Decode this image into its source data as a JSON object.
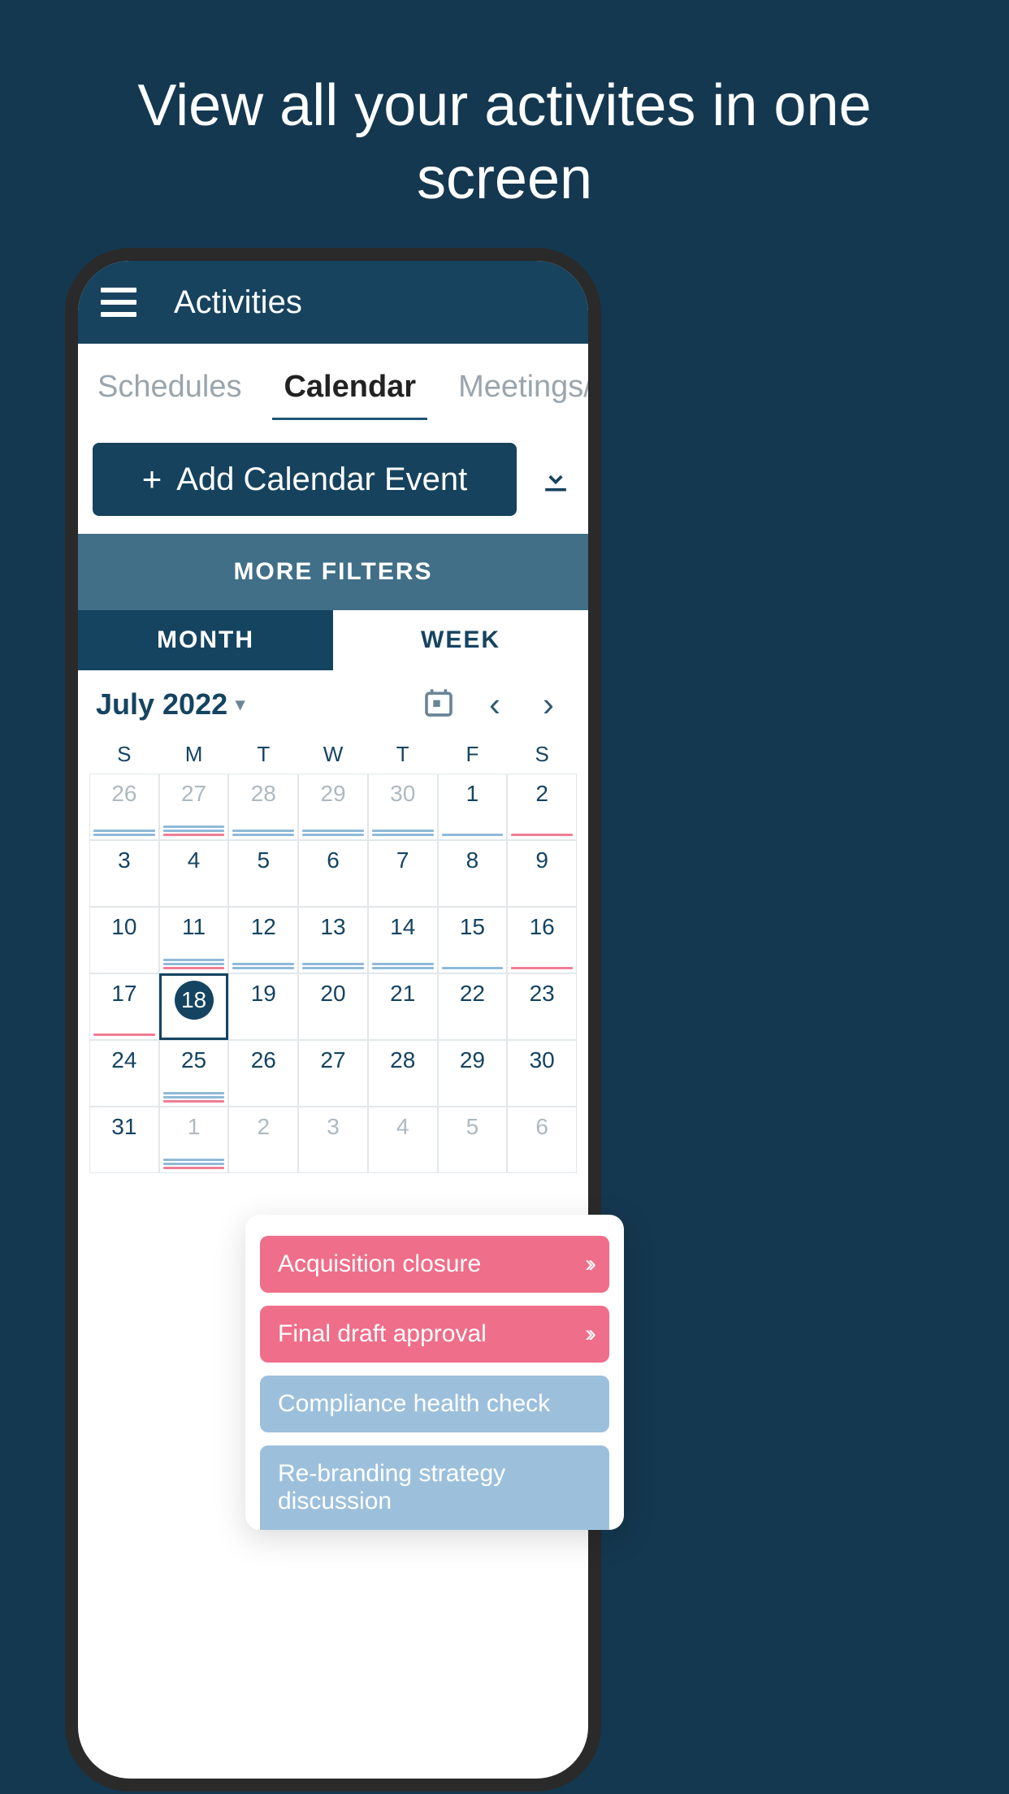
{
  "hero": "View all your activites in one screen",
  "header": {
    "title": "Activities"
  },
  "tabs": {
    "schedules": "Schedules",
    "calendar": "Calendar",
    "meetings": "Meetings/Ev"
  },
  "add_button": "Add Calendar Event",
  "more_filters": "MORE FILTERS",
  "view": {
    "month": "MONTH",
    "week": "WEEK"
  },
  "month_label": "July 2022",
  "weekdays": [
    "S",
    "M",
    "T",
    "W",
    "T",
    "F",
    "S"
  ],
  "weeks": [
    [
      {
        "n": "26",
        "muted": true,
        "marks": [
          "blue",
          "blue"
        ]
      },
      {
        "n": "27",
        "muted": true,
        "marks": [
          "blue",
          "blue",
          "pink"
        ]
      },
      {
        "n": "28",
        "muted": true,
        "marks": [
          "blue",
          "blue"
        ]
      },
      {
        "n": "29",
        "muted": true,
        "marks": [
          "blue",
          "blue"
        ]
      },
      {
        "n": "30",
        "muted": true,
        "marks": [
          "blue",
          "blue"
        ]
      },
      {
        "n": "1",
        "marks": [
          "blue"
        ]
      },
      {
        "n": "2",
        "marks": [
          "pink"
        ]
      }
    ],
    [
      {
        "n": "3"
      },
      {
        "n": "4"
      },
      {
        "n": "5"
      },
      {
        "n": "6"
      },
      {
        "n": "7"
      },
      {
        "n": "8"
      },
      {
        "n": "9"
      }
    ],
    [
      {
        "n": "10"
      },
      {
        "n": "11",
        "marks": [
          "blue",
          "blue",
          "pink"
        ]
      },
      {
        "n": "12",
        "marks": [
          "blue",
          "blue"
        ]
      },
      {
        "n": "13",
        "marks": [
          "blue",
          "blue"
        ]
      },
      {
        "n": "14",
        "marks": [
          "blue",
          "blue"
        ]
      },
      {
        "n": "15",
        "marks": [
          "blue"
        ]
      },
      {
        "n": "16",
        "marks": [
          "pink"
        ]
      }
    ],
    [
      {
        "n": "17",
        "marks": [
          "pink"
        ]
      },
      {
        "n": "18",
        "today": true
      },
      {
        "n": "19"
      },
      {
        "n": "20"
      },
      {
        "n": "21"
      },
      {
        "n": "22"
      },
      {
        "n": "23"
      }
    ],
    [
      {
        "n": "24"
      },
      {
        "n": "25",
        "marks": [
          "blue",
          "blue",
          "pink"
        ]
      },
      {
        "n": "26"
      },
      {
        "n": "27"
      },
      {
        "n": "28"
      },
      {
        "n": "29"
      },
      {
        "n": "30"
      }
    ],
    [
      {
        "n": "31"
      },
      {
        "n": "1",
        "muted": true,
        "marks": [
          "blue",
          "blue",
          "pink"
        ]
      },
      {
        "n": "2",
        "muted": true
      },
      {
        "n": "3",
        "muted": true
      },
      {
        "n": "4",
        "muted": true
      },
      {
        "n": "5",
        "muted": true
      },
      {
        "n": "6",
        "muted": true
      }
    ]
  ],
  "events": [
    {
      "label": "Acquisition closure",
      "color": "pink",
      "chevron": true
    },
    {
      "label": "Final draft approval",
      "color": "pink",
      "chevron": true
    },
    {
      "label": "Compliance health check",
      "color": "blue",
      "chevron": false
    },
    {
      "label": "Re-branding strategy discussion",
      "color": "blue",
      "chevron": false
    }
  ]
}
